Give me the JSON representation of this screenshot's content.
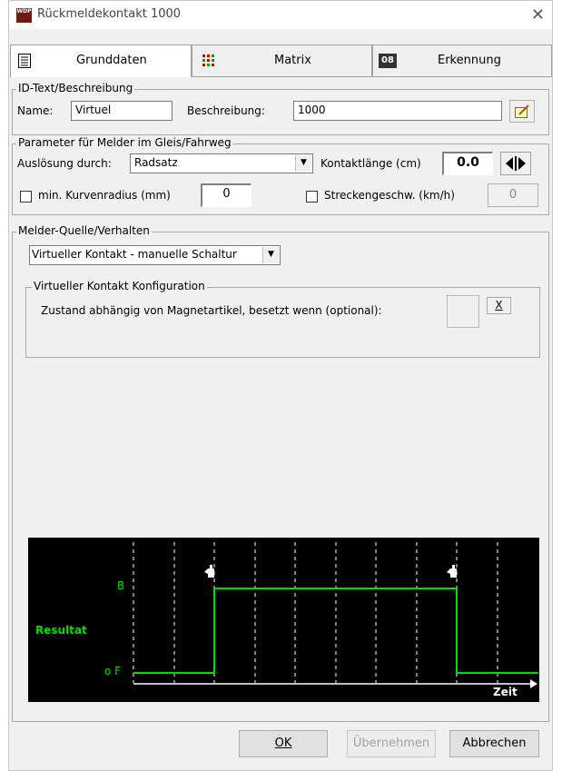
{
  "window": {
    "title": "Rückmeldekontakt 1000",
    "close": "✕",
    "app_icon_text": "WDP"
  },
  "tabs": [
    {
      "label": "Grunddaten",
      "icon": "list-icon"
    },
    {
      "label": "Matrix",
      "icon": "matrix-icon"
    },
    {
      "label": "Erkennung",
      "icon_text": "08"
    }
  ],
  "id_group": {
    "title": "ID-Text/Beschreibung",
    "name_label": "Name:",
    "name_value": "Virtuel",
    "desc_label": "Beschreibung:",
    "desc_value": "1000"
  },
  "param_group": {
    "title": "Parameter für Melder im Gleis/Fahrweg",
    "trigger_label": "Auslösung durch:",
    "trigger_value": "Radsatz",
    "length_label": "Kontaktlänge (cm)",
    "length_value": "0.0",
    "min_radius_label": "min. Kurvenradius (mm)",
    "min_radius_value": "0",
    "track_speed_label": "Streckengeschw. (km/h)",
    "track_speed_value": "0"
  },
  "source_group": {
    "title": "Melder-Quelle/Verhalten",
    "source_value": "Virtueller Kontakt - manuelle Schaltur",
    "config_title": "Virtueller Kontakt Konfiguration",
    "state_label": "Zustand abhängig von Magnetartikel, besetzt wenn (optional):",
    "clear_label": "X"
  },
  "diagram": {
    "label_b": "B",
    "label_f": "o F",
    "result_label": "Resultat",
    "axis_label": "Zeit",
    "trace_color": "#00dd00",
    "background": "#000000"
  },
  "buttons": {
    "ok": "OK",
    "apply": "Übernehmen",
    "cancel": "Abbrechen"
  }
}
